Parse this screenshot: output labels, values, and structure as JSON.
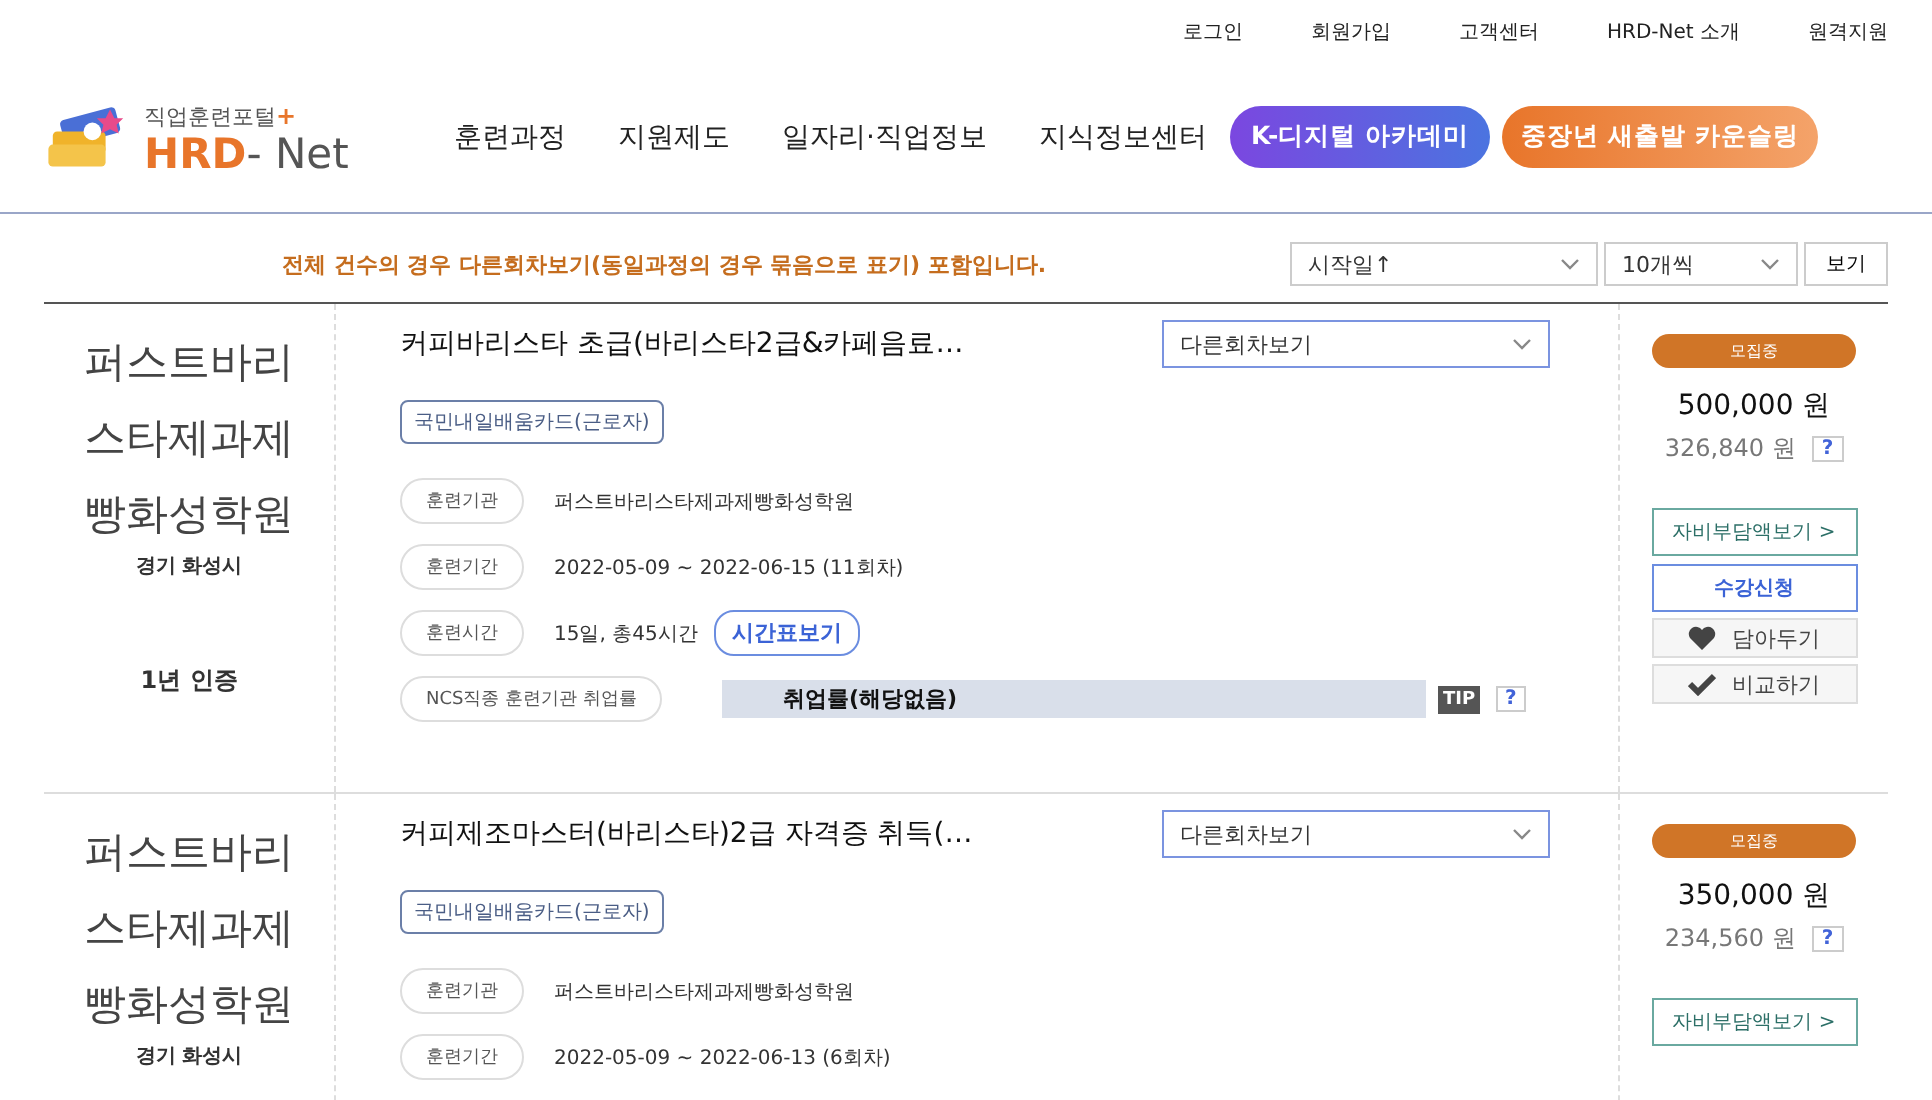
{
  "util_links": [
    "로그인",
    "회원가입",
    "고객센터",
    "HRD-Net 소개",
    "원격지원"
  ],
  "logo": {
    "tagline": "직업훈련포털",
    "plus": "+",
    "brand": "HRD",
    "brand_rest": "- Net"
  },
  "nav": [
    "훈련과정",
    "지원제도",
    "일자리·직업정보",
    "지식정보센터"
  ],
  "promo_buttons": [
    {
      "label": "K-디지털 아카데미",
      "kind": "purple"
    },
    {
      "label": "중장년 새출발 카운슬링",
      "kind": "orange"
    }
  ],
  "notice": "전체 건수의 경우 다른회차보기(동일과정의 경우 묶음으로 표기) 포함입니다.",
  "sort": {
    "value": "시작일↑"
  },
  "page_size": {
    "value": "10개씩"
  },
  "view_button": "보기",
  "courses": [
    {
      "org": "퍼스트바리스타제과제빵화성학원",
      "region": "경기 화성시",
      "cert": "1년 인증",
      "title": "커피바리스타 초급(바리스타2급&카페음료…",
      "other_rounds": "다른회차보기",
      "card_tag": "국민내일배움카드(근로자)",
      "rows": [
        {
          "kind": "text",
          "label": "훈련기관",
          "value": "퍼스트바리스타제과제빵화성학원"
        },
        {
          "kind": "text",
          "label": "훈련기간",
          "value": "2022-05-09 ~ 2022-06-15 (11회차)"
        },
        {
          "kind": "button",
          "label": "훈련시간",
          "value": "15일, 총45시간",
          "button": "시간표보기"
        },
        {
          "kind": "bar",
          "label": "NCS직종 훈련기관 취업률",
          "value": "취업률(해당없음)",
          "tip": "TIP",
          "help": "?"
        }
      ],
      "status": "모집중",
      "price": "500,000 원",
      "self_pay": "326,840 원",
      "help": "?",
      "self_pay_button": "자비부담액보기 >",
      "apply_button": "수강신청",
      "save_button": "담아두기",
      "compare_button": "비교하기"
    },
    {
      "org": "퍼스트바리스타제과제빵화성학원",
      "region": "경기 화성시",
      "title": "커피제조마스터(바리스타)2급 자격증 취득(…",
      "other_rounds": "다른회차보기",
      "card_tag": "국민내일배움카드(근로자)",
      "rows": [
        {
          "kind": "text",
          "label": "훈련기관",
          "value": "퍼스트바리스타제과제빵화성학원"
        },
        {
          "kind": "text",
          "label": "훈련기간",
          "value": "2022-05-09 ~ 2022-06-13 (6회차)"
        }
      ],
      "status": "모집중",
      "price": "350,000 원",
      "self_pay": "234,560 원",
      "help": "?",
      "self_pay_button": "자비부담액보기 >"
    }
  ]
}
